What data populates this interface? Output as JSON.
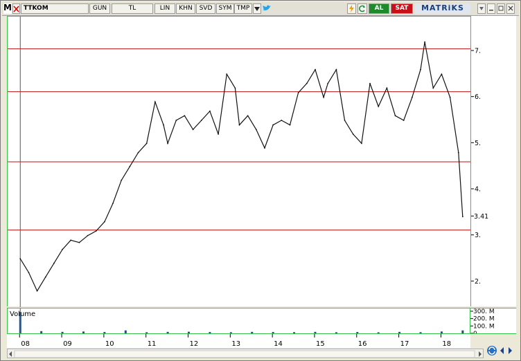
{
  "toolbar": {
    "menu_label": "M",
    "symbol": "TTKOM",
    "period": "GUN",
    "currency": "TL",
    "buttons": [
      "LIN",
      "KHN",
      "SVD",
      "SYM",
      "TMP"
    ],
    "buy_label": "AL",
    "sell_label": "SAT",
    "brand": "MATRiKS"
  },
  "chart_data": [
    {
      "type": "line",
      "x_ticks": [
        "08",
        "09",
        "10",
        "11",
        "12",
        "13",
        "14",
        "15",
        "16",
        "17",
        "18"
      ],
      "y_ticks": [
        "7.",
        "6.",
        "5.",
        "4.",
        "3.",
        "2."
      ],
      "y_tick_values": [
        7,
        6,
        5,
        4,
        3,
        2
      ],
      "ylim": [
        1.45,
        7.75
      ],
      "last_value_label": "3.41",
      "last_value": 3.41,
      "grid": false,
      "horizontal_lines": [
        7.05,
        6.12,
        4.6,
        3.12
      ],
      "vertical_marker_x": 2008.0,
      "x": [
        2008.0,
        2008.2,
        2008.4,
        2008.6,
        2008.8,
        2009.0,
        2009.2,
        2009.4,
        2009.6,
        2009.8,
        2010.0,
        2010.2,
        2010.4,
        2010.6,
        2010.8,
        2011.0,
        2011.2,
        2011.4,
        2011.5,
        2011.7,
        2011.9,
        2012.1,
        2012.3,
        2012.5,
        2012.7,
        2012.9,
        2013.1,
        2013.2,
        2013.4,
        2013.6,
        2013.8,
        2014.0,
        2014.2,
        2014.4,
        2014.6,
        2014.8,
        2015.0,
        2015.2,
        2015.3,
        2015.5,
        2015.7,
        2015.9,
        2016.1,
        2016.3,
        2016.5,
        2016.7,
        2016.9,
        2017.1,
        2017.3,
        2017.5,
        2017.6,
        2017.8,
        2018.0,
        2018.2,
        2018.4,
        2018.5
      ],
      "values": [
        2.5,
        2.2,
        1.8,
        2.1,
        2.4,
        2.7,
        2.9,
        2.85,
        3.0,
        3.1,
        3.3,
        3.7,
        4.2,
        4.5,
        4.8,
        5.0,
        5.9,
        5.4,
        5.0,
        5.5,
        5.6,
        5.3,
        5.5,
        5.7,
        5.2,
        6.5,
        6.2,
        5.4,
        5.6,
        5.3,
        4.9,
        5.4,
        5.5,
        5.4,
        6.1,
        6.3,
        6.6,
        6.0,
        6.3,
        6.6,
        5.5,
        5.2,
        5.0,
        6.3,
        5.8,
        6.2,
        5.6,
        5.5,
        6.0,
        6.6,
        7.2,
        6.2,
        6.5,
        6.0,
        4.8,
        3.41
      ]
    },
    {
      "type": "bar",
      "title": "Volume",
      "y_ticks": [
        "300. M",
        "200. M",
        "100. M",
        "0"
      ],
      "y_tick_values": [
        300,
        200,
        100,
        0
      ],
      "ylim": [
        0,
        300
      ],
      "x": [
        2008.0,
        2008.5,
        2009.0,
        2009.5,
        2010.0,
        2010.5,
        2011.0,
        2011.5,
        2012.0,
        2012.5,
        2013.0,
        2013.5,
        2014.0,
        2014.5,
        2015.0,
        2015.5,
        2016.0,
        2016.5,
        2017.0,
        2017.5,
        2018.0,
        2018.5
      ],
      "values": [
        290,
        30,
        20,
        25,
        18,
        40,
        15,
        20,
        22,
        18,
        15,
        20,
        18,
        16,
        20,
        15,
        18,
        14,
        20,
        16,
        25,
        40
      ]
    }
  ]
}
